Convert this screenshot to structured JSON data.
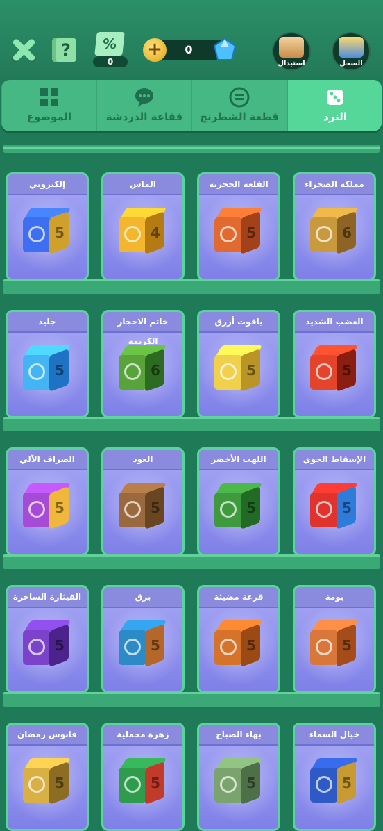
{
  "header": {
    "discount_icon": "%",
    "discount_count": "0",
    "help_icon": "?",
    "coin_plus_icon": "+",
    "currency_value": "0",
    "exchange_label": "استبدال",
    "record_label": "السجل"
  },
  "tabs": [
    {
      "label": "النرد",
      "icon": "dice-icon",
      "active": true
    },
    {
      "label": "قطعة الشطرنج",
      "icon": "chess-piece-icon",
      "active": false
    },
    {
      "label": "فقاعة الدردشة",
      "icon": "chat-bubble-icon",
      "active": false
    },
    {
      "label": "الموضوع",
      "icon": "theme-grid-icon",
      "active": false
    }
  ],
  "rows": [
    [
      {
        "title": "مملكة الصحراء",
        "color": "#c99a3d",
        "side": "#8d6423",
        "number": "6"
      },
      {
        "title": "القلعة الحجرية",
        "color": "#e06a2f",
        "side": "#a34118",
        "number": "5"
      },
      {
        "title": "الماس",
        "color": "#f3b62c",
        "side": "#b37b12",
        "number": "4"
      },
      {
        "title": "إلكتروني",
        "color": "#3d6ff0",
        "side": "#cfa12b",
        "number": "5"
      }
    ],
    [
      {
        "title": "الغضب الشديد",
        "color": "#e4452a",
        "side": "#8a1e10",
        "number": "5"
      },
      {
        "title": "ياقوت أزرق",
        "color": "#f1d04b",
        "side": "#b99525",
        "number": "5"
      },
      {
        "title": "خاتم الاحجار الكريمة",
        "color": "#58a43b",
        "side": "#2d6b22",
        "number": "6"
      },
      {
        "title": "جليد",
        "color": "#43b5f4",
        "side": "#1f73c5",
        "number": "5"
      }
    ],
    [
      {
        "title": "الإسقاط الجوي",
        "color": "#e0332e",
        "side": "#2e7cd9",
        "number": "5"
      },
      {
        "title": "اللهب الأخضر",
        "color": "#3f9a3e",
        "side": "#216b24",
        "number": "5"
      },
      {
        "title": "العود",
        "color": "#9a6a3e",
        "side": "#6a4522",
        "number": "5"
      },
      {
        "title": "الصراف الآلي",
        "color": "#a54bd6",
        "side": "#f0b83a",
        "number": "5"
      }
    ],
    [
      {
        "title": "بومة",
        "color": "#d9773a",
        "side": "#a44d1b",
        "number": "5"
      },
      {
        "title": "قرعة مضيئة",
        "color": "#d5732b",
        "side": "#9c4a14",
        "number": "5"
      },
      {
        "title": "برق",
        "color": "#2c8ac7",
        "side": "#b5672a",
        "number": "5"
      },
      {
        "title": "القيثارة الساحرة",
        "color": "#7a43c9",
        "side": "#4c238a",
        "number": "5"
      }
    ],
    [
      {
        "title": "خيال السماء",
        "color": "#2e5ac7",
        "side": "#c79a32",
        "number": "5"
      },
      {
        "title": "بهاء الصباح",
        "color": "#7aa36d",
        "side": "#4e7046",
        "number": "5"
      },
      {
        "title": "زهرة مخملية",
        "color": "#2f9b4d",
        "side": "#c23a2a",
        "number": "5"
      },
      {
        "title": "فانوس رمضان",
        "color": "#d8b046",
        "side": "#8d6d22",
        "number": "5"
      }
    ]
  ]
}
